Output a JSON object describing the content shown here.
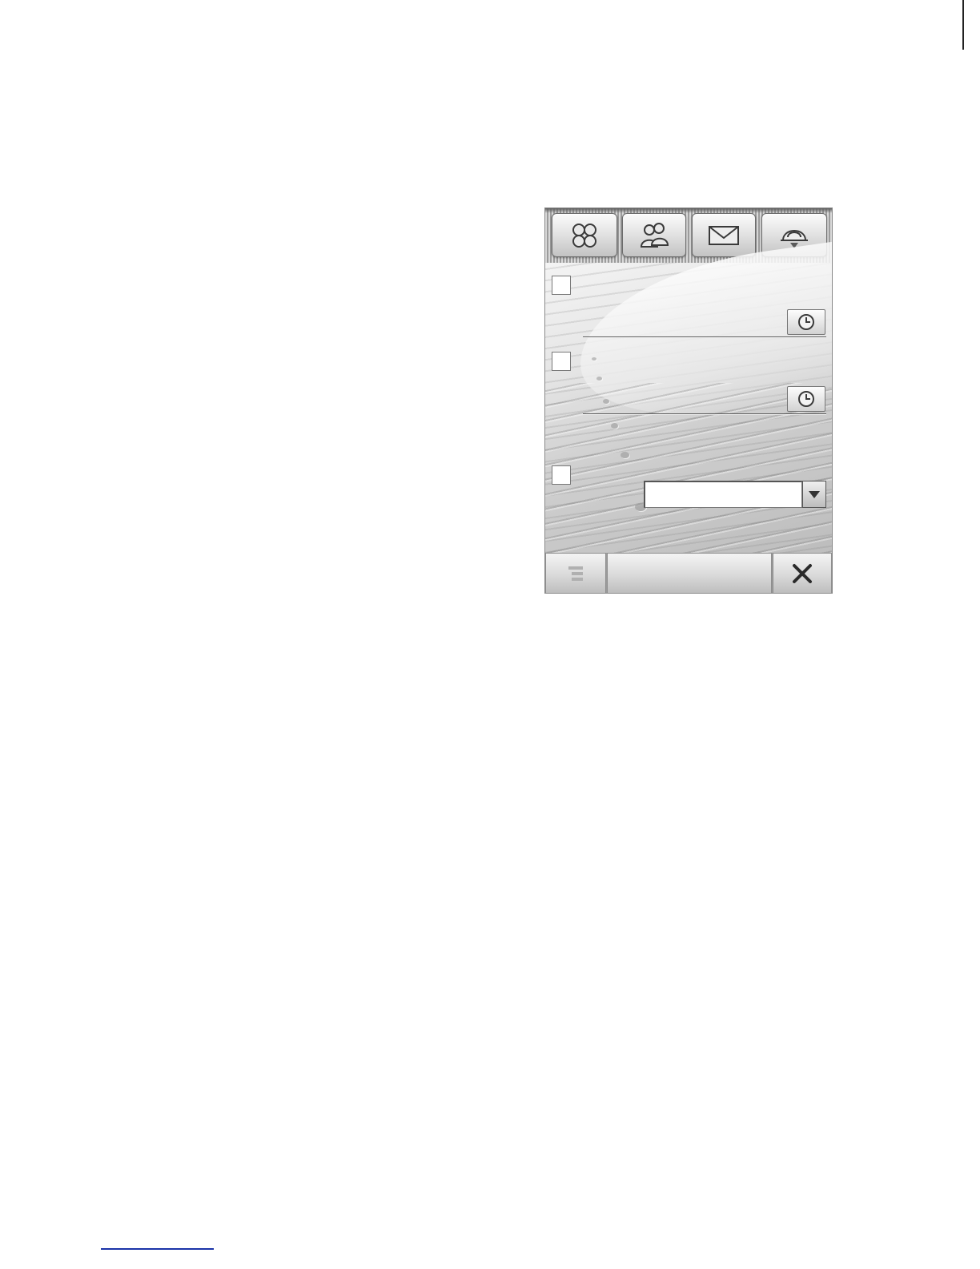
{
  "toolbar": {
    "buttons": [
      {
        "icon": "apps-grid-icon"
      },
      {
        "icon": "contacts-icon"
      },
      {
        "icon": "mail-icon"
      },
      {
        "icon": "profile-bell-icon"
      }
    ]
  },
  "form": {
    "rows": [
      {
        "checkbox_checked": false,
        "has_clock": true
      },
      {
        "checkbox_checked": false,
        "has_clock": true
      },
      {
        "checkbox_checked": false,
        "has_select": true
      }
    ],
    "select": {
      "value": ""
    }
  },
  "bottombar": {
    "left_icon": "menu-icon",
    "center_label": "",
    "right_icon": "close-icon"
  }
}
